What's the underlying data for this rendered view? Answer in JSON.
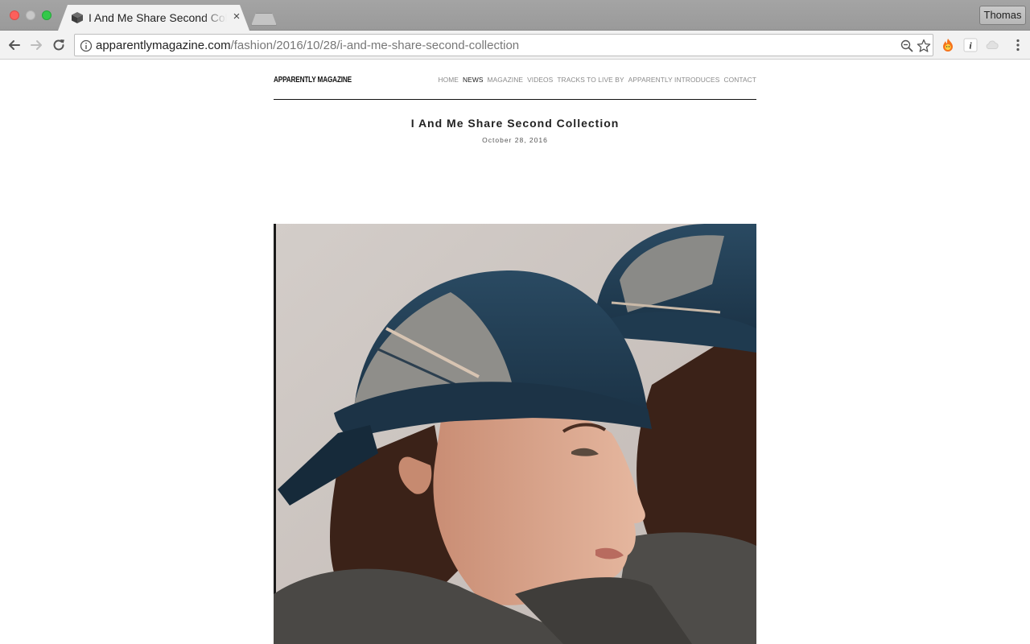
{
  "browser": {
    "tab_title": "I And Me Share Second Collection",
    "tab_close": "×",
    "profile_name": "Thomas",
    "url_host": "apparentlymagazine.com",
    "url_path": "/fashion/2016/10/28/i-and-me-share-second-collection",
    "icons": {
      "back": "arrow-left-icon",
      "forward": "arrow-right-icon",
      "reload": "reload-icon",
      "site_info": "info-icon",
      "zoom": "zoom-out-icon",
      "bookmark": "star-icon",
      "extension_1": "flame-icon",
      "extension_2": "info-extension-icon",
      "extension_3": "cloud-icon",
      "menu": "kebab-menu-icon"
    }
  },
  "site": {
    "logo": "APPARENTLY MAGAZINE",
    "nav": [
      {
        "label": "HOME",
        "active": false
      },
      {
        "label": "NEWS",
        "active": true
      },
      {
        "label": "MAGAZINE",
        "active": false
      },
      {
        "label": "VIDEOS",
        "active": false
      },
      {
        "label": "TRACKS TO LIVE BY",
        "active": false
      },
      {
        "label": "APPARENTLY INTRODUCES",
        "active": false
      },
      {
        "label": "CONTACT",
        "active": false
      }
    ]
  },
  "post": {
    "title": "I And Me Share Second Collection",
    "date": "October 28, 2016"
  },
  "colors": {
    "denim": "#1f3a4f",
    "hat_panel": "#8a8a87",
    "wall": "#cdc6c2",
    "hair": "#3b2218",
    "skin": "#d9a48a",
    "sweater": "#4a4845"
  }
}
